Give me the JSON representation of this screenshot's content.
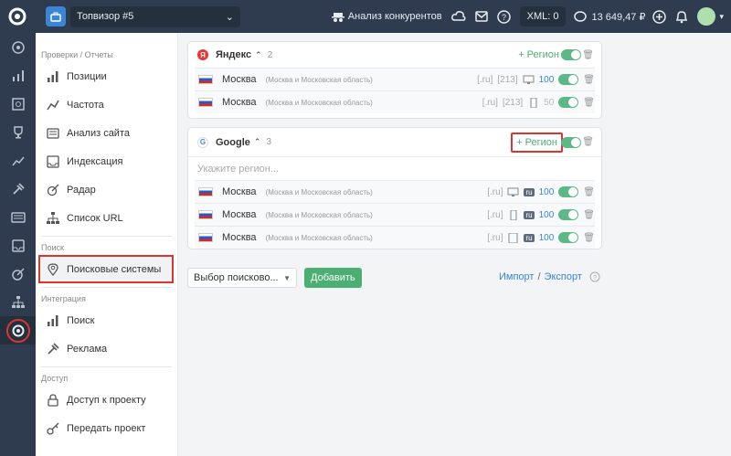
{
  "topbar": {
    "project": "Топвизор #5",
    "competitors": "Анализ конкурентов",
    "xml": "XML: 0",
    "balance": "13 649,47 ₽"
  },
  "subnav": {
    "sec1": "Проверки / Отчеты",
    "items1": [
      "Позиции",
      "Частота",
      "Анализ сайта",
      "Индексация",
      "Радар",
      "Список URL"
    ],
    "sec2": "Поиск",
    "items2": [
      "Поисковые системы"
    ],
    "sec3": "Интеграция",
    "items3": [
      "Поиск",
      "Реклама"
    ],
    "sec4": "Доступ",
    "items4": [
      "Доступ к проекту",
      "Передать проект"
    ]
  },
  "yandex": {
    "name": "Яндекс",
    "count": "2",
    "region_btn": "+ Регион",
    "rows": [
      {
        "city": "Москва",
        "region": "(Москва и Московская область)",
        "domain": "[.ru]",
        "code": "[213]",
        "device": "desktop",
        "depth": "100"
      },
      {
        "city": "Москва",
        "region": "(Москва и Московская область)",
        "domain": "[.ru]",
        "code": "[213]",
        "device": "mobile",
        "depth": "50"
      }
    ]
  },
  "google": {
    "name": "Google",
    "count": "3",
    "region_btn": "+ Регион",
    "placeholder": "Укажите регион...",
    "rows": [
      {
        "city": "Москва",
        "region": "(Москва и Московская область)",
        "domain": "[.ru]",
        "chip": "ru",
        "device": "desktop",
        "depth": "100"
      },
      {
        "city": "Москва",
        "region": "(Москва и Московская область)",
        "domain": "[.ru]",
        "chip": "ru",
        "device": "mobile",
        "depth": "100"
      },
      {
        "city": "Москва",
        "region": "(Москва и Московская область)",
        "domain": "[.ru]",
        "chip": "ru",
        "device": "tablet",
        "depth": "100"
      }
    ]
  },
  "bottom": {
    "select": "Выбор поисково...",
    "add": "Добавить",
    "import": "Импорт",
    "slash": "/",
    "export": "Экспорт"
  },
  "colors": {
    "accent": "#4caf72",
    "link": "#3a85d6",
    "highlight": "#d9362f",
    "topbar": "#2f3c50"
  }
}
